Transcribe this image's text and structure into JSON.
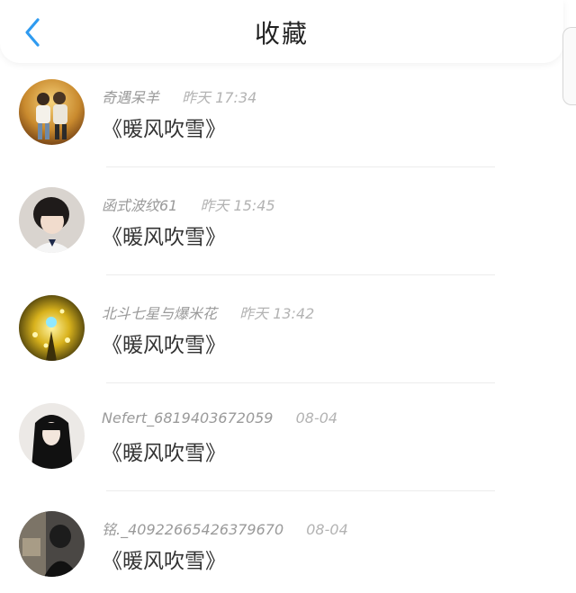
{
  "header": {
    "title": "收藏"
  },
  "items": [
    {
      "name": "奇遇呆羊",
      "time": "昨天 17:34",
      "content": "《暖风吹雪》"
    },
    {
      "name": "函式波纹61",
      "time": "昨天 15:45",
      "content": "《暖风吹雪》"
    },
    {
      "name": "北斗七星与爆米花",
      "time": "昨天 13:42",
      "content": "《暖风吹雪》"
    },
    {
      "name": "Nefert_6819403672059",
      "time": "08-04",
      "content": "《暖风吹雪》"
    },
    {
      "name": "铭._40922665426379670",
      "time": "08-04",
      "content": "《暖风吹雪》"
    }
  ],
  "colors": {
    "accent": "#2f9bf0"
  }
}
